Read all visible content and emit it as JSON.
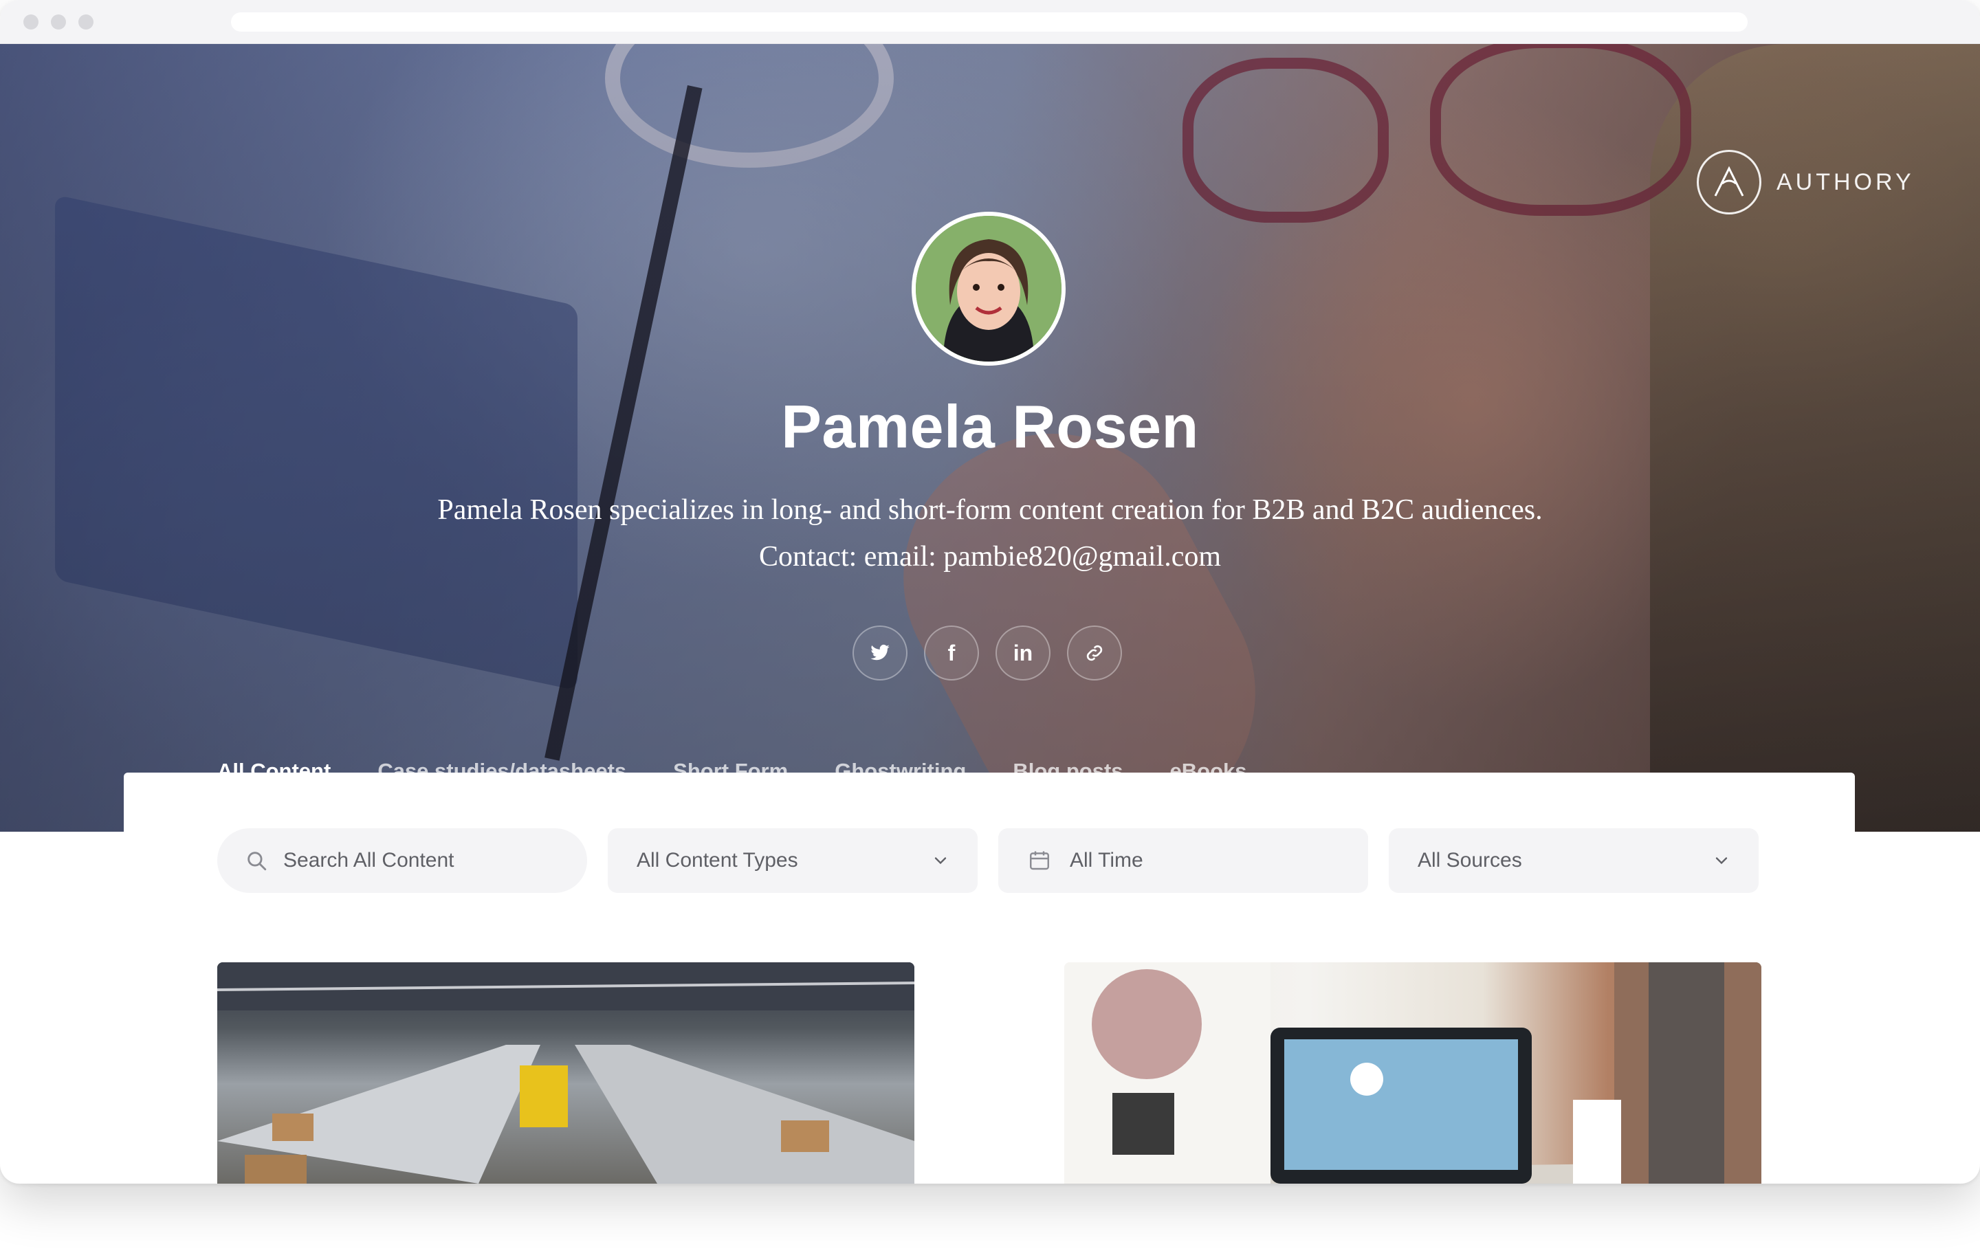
{
  "brand": {
    "name": "AUTHORY",
    "logo_icon": "authory-logo-icon"
  },
  "profile": {
    "name": "Pamela Rosen",
    "bio": "Pamela Rosen specializes in long- and short-form content creation for B2B and B2C audiences. Contact: email: pambie820@gmail.com",
    "avatar_icon": "profile-avatar"
  },
  "socials": [
    {
      "name": "twitter",
      "icon": "twitter-icon"
    },
    {
      "name": "facebook",
      "icon": "facebook-icon",
      "glyph": "f"
    },
    {
      "name": "linkedin",
      "icon": "linkedin-icon",
      "glyph": "in"
    },
    {
      "name": "link",
      "icon": "link-icon"
    }
  ],
  "tabs": [
    {
      "label": "All Content",
      "active": true
    },
    {
      "label": "Case studies/datasheets",
      "active": false
    },
    {
      "label": "Short Form",
      "active": false
    },
    {
      "label": "Ghostwriting",
      "active": false
    },
    {
      "label": "Blog posts",
      "active": false
    },
    {
      "label": "eBooks",
      "active": false
    }
  ],
  "filters": {
    "search_placeholder": "Search All Content",
    "content_types": "All Content Types",
    "time": "All Time",
    "sources": "All Sources"
  },
  "cards": [
    {
      "image": "warehouse-conveyor-photo"
    },
    {
      "image": "laptop-desk-photo"
    }
  ],
  "colors": {
    "accent": "#3e6ff2",
    "filter_bg": "#f4f4f6",
    "text_muted": "#5f6066"
  }
}
